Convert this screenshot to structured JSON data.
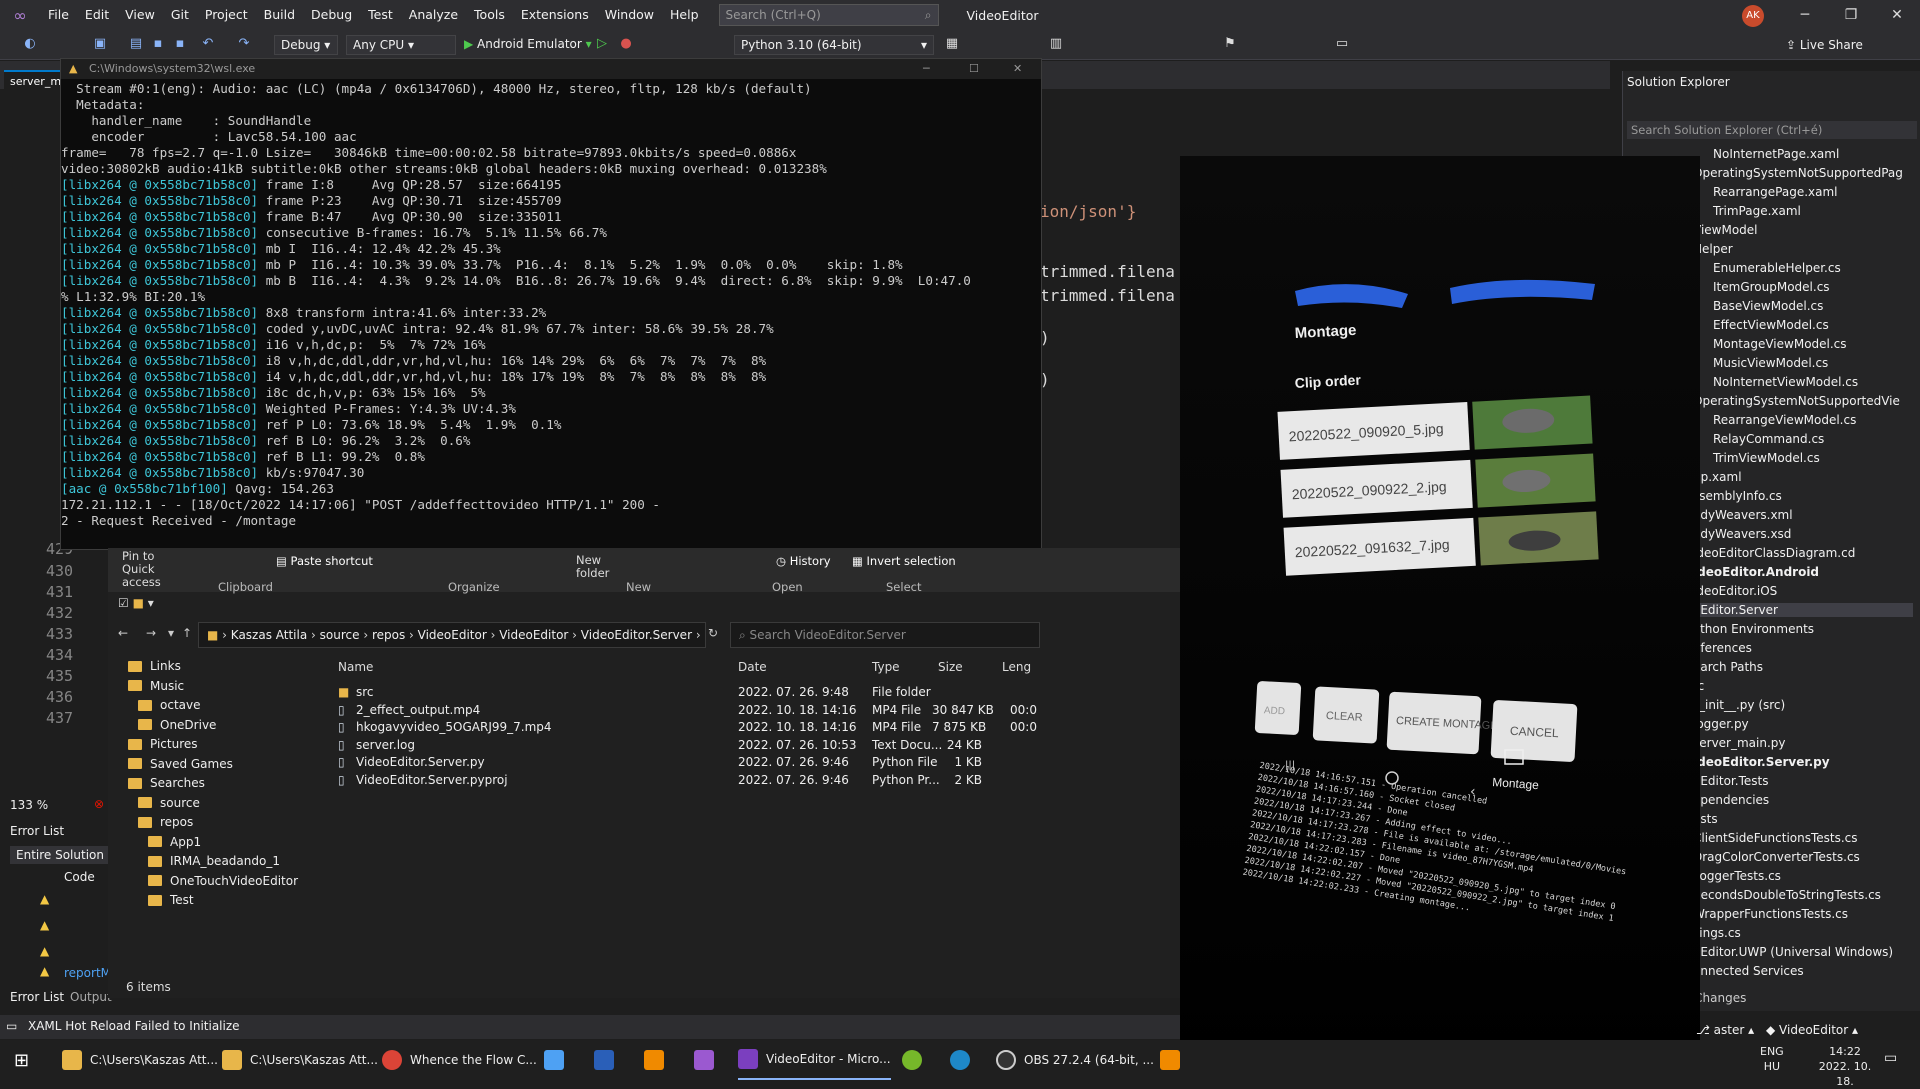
{
  "vs": {
    "menu": [
      "File",
      "Edit",
      "View",
      "Git",
      "Project",
      "Build",
      "Debug",
      "Test",
      "Analyze",
      "Tools",
      "Extensions",
      "Window",
      "Help"
    ],
    "search_placeholder": "Search (Ctrl+Q)",
    "title": "VideoEditor",
    "avatar": "AK",
    "toolbar": {
      "config": "Debug",
      "platform": "Any CPU",
      "run_target": "Android Emulator",
      "python": "Python 3.10 (64-bit)",
      "live_share": "Live Share"
    },
    "editor_tab": "server_m",
    "code_lines": [
      "ion/json'}",
      "trimmed.filena",
      "trimmed.filena",
      ")",
      ")"
    ],
    "line_numbers": [
      "429",
      "430",
      "431",
      "432",
      "433",
      "434",
      "435",
      "436",
      "437"
    ],
    "zoom": "133 %",
    "status_message": "XAML Hot Reload Failed to Initialize",
    "error_list": {
      "title": "Error List",
      "scope": "Entire Solution",
      "code_header": "Code",
      "tabs": [
        "Error List",
        "Output"
      ],
      "report_item": "reportMi"
    }
  },
  "terminal": {
    "title": "C:\\Windows\\system32\\wsl.exe",
    "lines": [
      {
        "tag": "",
        "text": "  Stream #0:1(eng): Audio: aac (LC) (mp4a / 0x6134706D), 48000 Hz, stereo, fltp, 128 kb/s (default)"
      },
      {
        "tag": "",
        "text": "  Metadata:"
      },
      {
        "tag": "",
        "text": "    handler_name    : SoundHandle"
      },
      {
        "tag": "",
        "text": "    encoder         : Lavc58.54.100 aac"
      },
      {
        "tag": "",
        "text": "frame=   78 fps=2.7 q=-1.0 Lsize=   30846kB time=00:00:02.58 bitrate=97893.0kbits/s speed=0.0886x"
      },
      {
        "tag": "",
        "text": "video:30802kB audio:41kB subtitle:0kB other streams:0kB global headers:0kB muxing overhead: 0.013238%"
      },
      {
        "tag": "[libx264 @ 0x558bc71b58c0]",
        "text": " frame I:8     Avg QP:28.57  size:664195"
      },
      {
        "tag": "[libx264 @ 0x558bc71b58c0]",
        "text": " frame P:23    Avg QP:30.71  size:455709"
      },
      {
        "tag": "[libx264 @ 0x558bc71b58c0]",
        "text": " frame B:47    Avg QP:30.90  size:335011"
      },
      {
        "tag": "[libx264 @ 0x558bc71b58c0]",
        "text": " consecutive B-frames: 16.7%  5.1% 11.5% 66.7%"
      },
      {
        "tag": "[libx264 @ 0x558bc71b58c0]",
        "text": " mb I  I16..4: 12.4% 42.2% 45.3%"
      },
      {
        "tag": "[libx264 @ 0x558bc71b58c0]",
        "text": " mb P  I16..4: 10.3% 39.0% 33.7%  P16..4:  8.1%  5.2%  1.9%  0.0%  0.0%    skip: 1.8%"
      },
      {
        "tag": "[libx264 @ 0x558bc71b58c0]",
        "text": " mb B  I16..4:  4.3%  9.2% 14.0%  B16..8: 26.7% 19.6%  9.4%  direct: 6.8%  skip: 9.9%  L0:47.0"
      },
      {
        "tag": "",
        "text": "% L1:32.9% BI:20.1%"
      },
      {
        "tag": "[libx264 @ 0x558bc71b58c0]",
        "text": " 8x8 transform intra:41.6% inter:33.2%"
      },
      {
        "tag": "[libx264 @ 0x558bc71b58c0]",
        "text": " coded y,uvDC,uvAC intra: 92.4% 81.9% 67.7% inter: 58.6% 39.5% 28.7%"
      },
      {
        "tag": "[libx264 @ 0x558bc71b58c0]",
        "text": " i16 v,h,dc,p:  5%  7% 72% 16%"
      },
      {
        "tag": "[libx264 @ 0x558bc71b58c0]",
        "text": " i8 v,h,dc,ddl,ddr,vr,hd,vl,hu: 16% 14% 29%  6%  6%  7%  7%  7%  8%"
      },
      {
        "tag": "[libx264 @ 0x558bc71b58c0]",
        "text": " i4 v,h,dc,ddl,ddr,vr,hd,vl,hu: 18% 17% 19%  8%  7%  8%  8%  8%  8%"
      },
      {
        "tag": "[libx264 @ 0x558bc71b58c0]",
        "text": " i8c dc,h,v,p: 63% 15% 16%  5%"
      },
      {
        "tag": "[libx264 @ 0x558bc71b58c0]",
        "text": " Weighted P-Frames: Y:4.3% UV:4.3%"
      },
      {
        "tag": "[libx264 @ 0x558bc71b58c0]",
        "text": " ref P L0: 73.6% 18.9%  5.4%  1.9%  0.1%"
      },
      {
        "tag": "[libx264 @ 0x558bc71b58c0]",
        "text": " ref B L0: 96.2%  3.2%  0.6%"
      },
      {
        "tag": "[libx264 @ 0x558bc71b58c0]",
        "text": " ref B L1: 99.2%  0.8%"
      },
      {
        "tag": "[libx264 @ 0x558bc71b58c0]",
        "text": " kb/s:97047.30"
      },
      {
        "tag": "[aac @ 0x558bc71bf100]",
        "text": " Qavg: 154.263"
      },
      {
        "tag": "",
        "text": "172.21.112.1 - - [18/Oct/2022 14:17:06] \"POST /addeffecttovideo HTTP/1.1\" 200 -"
      },
      {
        "tag": "",
        "text": "2 - Request Received - /montage"
      }
    ]
  },
  "explorer": {
    "ribbon": {
      "pin_quick": "Pin to Quick access",
      "paste_shortcut": "Paste shortcut",
      "history": "History",
      "invert_selection": "Invert selection",
      "new_folder": "New folder",
      "groups": [
        "Clipboard",
        "Organize",
        "New",
        "Open",
        "Select"
      ]
    },
    "breadcrumb": [
      "Kaszas Attila",
      "source",
      "repos",
      "VideoEditor",
      "VideoEditor",
      "VideoEditor.Server"
    ],
    "search_placeholder": "Search VideoEditor.Server",
    "nav": [
      "Links",
      "Music",
      "octave",
      "OneDrive",
      "Pictures",
      "Saved Games",
      "Searches",
      "source",
      "repos",
      "App1",
      "IRMA_beadando_1",
      "OneTouchVideoEditor",
      "Test"
    ],
    "columns": [
      "Name",
      "Date",
      "Type",
      "Size",
      "Leng"
    ],
    "files": [
      {
        "name": "src",
        "date": "2022. 07. 26. 9:48",
        "type": "File folder",
        "size": "",
        "len": ""
      },
      {
        "name": "2_effect_output.mp4",
        "date": "2022. 10. 18. 14:16",
        "type": "MP4 File",
        "size": "30 847 KB",
        "len": "00:0"
      },
      {
        "name": "hkogavyvideo_5OGARJ99_7.mp4",
        "date": "2022. 10. 18. 14:16",
        "type": "MP4 File",
        "size": "7 875 KB",
        "len": "00:0"
      },
      {
        "name": "server.log",
        "date": "2022. 07. 26. 10:53",
        "type": "Text Docu...",
        "size": "24 KB",
        "len": ""
      },
      {
        "name": "VideoEditor.Server.py",
        "date": "2022. 07. 26. 9:46",
        "type": "Python File",
        "size": "1 KB",
        "len": ""
      },
      {
        "name": "VideoEditor.Server.pyproj",
        "date": "2022. 07. 26. 9:46",
        "type": "Python Pr...",
        "size": "2 KB",
        "len": ""
      }
    ],
    "item_count": "6 items"
  },
  "solution": {
    "title": "Solution Explorer",
    "search": "Search Solution Explorer (Ctrl+é)",
    "items": [
      "NoInternetPage.xaml",
      "OperatingSystemNotSupportedPag",
      "RearrangePage.xaml",
      "TrimPage.xaml",
      "ViewModel",
      "Helper",
      "EnumerableHelper.cs",
      "ItemGroupModel.cs",
      "BaseViewModel.cs",
      "EffectViewModel.cs",
      "MontageViewModel.cs",
      "MusicViewModel.cs",
      "NoInternetViewModel.cs",
      "OperatingSystemNotSupportedVie",
      "RearrangeViewModel.cs",
      "RelayCommand.cs",
      "TrimViewModel.cs",
      "pp.xaml",
      "ssemblyInfo.cs",
      "odyWeavers.xml",
      "odyWeavers.xsd",
      "ideoEditorClassDiagram.cd",
      "ideoEditor.Android",
      "ideoEditor.iOS",
      "oEditor.Server",
      "ython Environments",
      "eferences",
      "earch Paths",
      "rc",
      "__init__.py (src)",
      "logger.py",
      "server_main.py",
      "ideoEditor.Server.py",
      "oEditor.Tests",
      "ependencies",
      "ests",
      "ClientSideFunctionsTests.cs",
      "DragColorConverterTests.cs",
      "LoggerTests.cs",
      "SecondsDoubleToStringTests.cs",
      "WrapperFunctionsTests.cs",
      "sings.cs",
      "oEditor.UWP (Universal Windows)",
      "onnected Services"
    ],
    "bottom_tabs": [
      "orer",
      "Git Changes"
    ],
    "branch": "aster",
    "repo": "VideoEditor"
  },
  "phone": {
    "montage_title": "Montage",
    "clip_order": "Clip order",
    "clips": [
      "20220522_090920_5.jpg",
      "20220522_090922_2.jpg",
      "20220522_091632_7.jpg"
    ],
    "buttons": [
      "ADD",
      "CLEAR",
      "CREATE MONTAGE",
      "CANCEL"
    ],
    "log_lines": [
      "2022/10/18 14:16:57.151 - Operation cancelled",
      "2022/10/18 14:16:57.160 - Socket closed",
      "2022/10/18 14:17:23.244 - Done",
      "2022/10/18 14:17:23.267 - Adding effect to video...",
      "2022/10/18 14:17:23.278 - File is available at: /storage/emulated/0/Movies",
      "2022/10/18 14:17:23.283 - Filename is video_87H7YGSM.mp4",
      "2022/10/18 14:22:02.157 - Done",
      "2022/10/18 14:22:02.207 - Moved \"20220522_090920_5.jpg\" to target index 0",
      "2022/10/18 14:22:02.227 - Moved \"20220522_090922_2.jpg\" to target index 1",
      "2022/10/18 14:22:02.233 - Creating montage..."
    ],
    "nav_label": "Montage"
  },
  "taskbar": {
    "items": [
      "C:\\Users\\Kaszas Att...",
      "C:\\Users\\Kaszas Att...",
      "Whence the Flow C...",
      "VideoEditor - Micro...",
      "OBS 27.2.4 (64-bit, ..."
    ],
    "lang": "ENG",
    "lang2": "HU",
    "time": "14:22",
    "date": "2022. 10. 18."
  }
}
